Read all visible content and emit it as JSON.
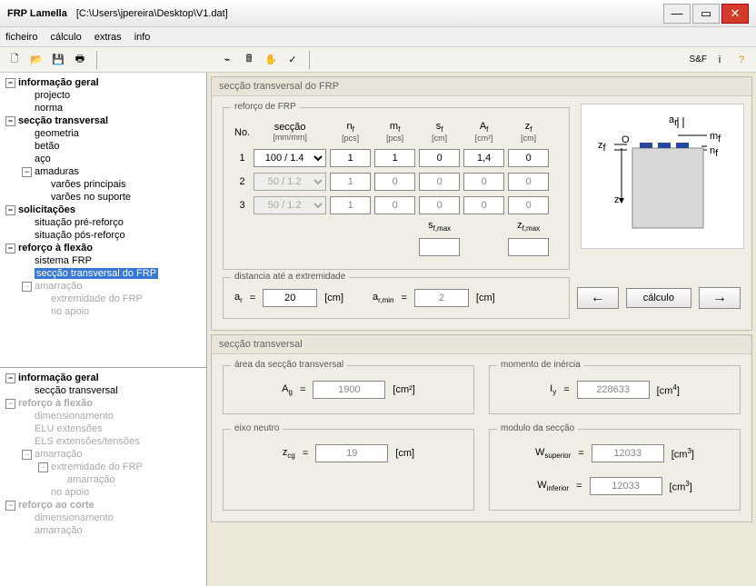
{
  "window": {
    "app": "FRP Lamella",
    "path": "[C:\\Users\\jpereira\\Desktop\\V1.dat]"
  },
  "menu": {
    "ficheiro": "ficheiro",
    "calculo": "cálculo",
    "extras": "extras",
    "info": "info"
  },
  "tree1": {
    "info_geral": "informação geral",
    "projecto": "projecto",
    "norma": "norma",
    "seccao_trans": "secção transversal",
    "geometria": "geometria",
    "betao": "betão",
    "aco": "aço",
    "amaduras": "amaduras",
    "varoes_principais": "varões principais",
    "varoes_suporte": "varões no suporte",
    "solicitacoes": "solicitações",
    "sit_pre": "situação pré-reforço",
    "sit_pos": "situação pós-reforço",
    "reforco_flexao": "reforço à flexão",
    "sistema_frp": "sistema FRP",
    "seccao_frp": "secção transversal do FRP",
    "amarracao": "amarração",
    "extremidade": "extremidade do FRP",
    "no_apoio": "no apoio"
  },
  "tree2": {
    "info_geral": "informação geral",
    "seccao_trans": "secção transversal",
    "reforco_flexao": "reforço à flexão",
    "dimensionamento": "dimensionamento",
    "elu": "ELU extensões",
    "els": "ELS extensões/tensões",
    "amarracao": "amarração",
    "extremidade": "extremidade do FRP",
    "amarracao2": "amarração",
    "no_apoio": "no apoio",
    "reforco_corte": "reforço ao corte",
    "dimensionamento2": "dimensionamento",
    "amarracao3": "amarração"
  },
  "panel1": {
    "title": "secção transversal do FRP",
    "reforco": "reforço de FRP",
    "no": "No.",
    "seccao": "secção",
    "seccao_u": "[mm/mm]",
    "nf": "n",
    "nf_sub": "f",
    "nf_u": "[pcs]",
    "mf": "m",
    "mf_sub": "f",
    "mf_u": "[pcs]",
    "sf": "s",
    "sf_sub": "f",
    "sf_u": "[cm]",
    "af": "A",
    "af_sub": "f",
    "af_u": "[cm²]",
    "zf": "z",
    "zf_sub": "f",
    "zf_u": "[cm]",
    "rows": [
      {
        "no": "1",
        "sec": "100 / 1.4",
        "nf": "1",
        "mf": "1",
        "sf": "0",
        "af": "1,4",
        "zf": "0",
        "active": true
      },
      {
        "no": "2",
        "sec": "50 / 1.2",
        "nf": "1",
        "mf": "0",
        "sf": "0",
        "af": "0",
        "zf": "0",
        "active": false
      },
      {
        "no": "3",
        "sec": "50 / 1.2",
        "nf": "1",
        "mf": "0",
        "sf": "0",
        "af": "0",
        "zf": "0",
        "active": false
      }
    ],
    "sfmax": "s",
    "sfmax_sub": "f,max",
    "zfmax": "z",
    "zfmax_sub": "f,max",
    "sfmax_val": "",
    "zfmax_val": "",
    "dist_label": "distancia até a extremidade",
    "ar": "a",
    "ar_sub": "r",
    "ar_val": "20",
    "armin": "a",
    "armin_sub": "r,min",
    "armin_val": "2",
    "cm": "[cm]",
    "calc": "cálculo",
    "diag": {
      "ar": "a",
      "ar_sub": "r",
      "zf": "z",
      "zf_sub": "f",
      "o": "O",
      "z": "z",
      "mf": "m",
      "mf_sub": "f",
      "nf": "n",
      "nf_sub": "f"
    }
  },
  "panel2": {
    "title": "secção transversal",
    "area": "área da secção transversal",
    "ag": "A",
    "ag_sub": "g",
    "ag_val": "1900",
    "ag_u": "[cm²]",
    "inercia": "momento de inércia",
    "iy": "I",
    "iy_sub": "y",
    "iy_val": "228633",
    "iy_u": "[cm",
    "iy_sup": "4",
    "iy_u2": "]",
    "eixo": "eixo neutro",
    "zcg": "z",
    "zcg_sub": "cg",
    "zcg_val": "19",
    "zcg_u": "[cm]",
    "modulo": "modulo da secção",
    "wsup": "W",
    "wsup_sub": "superior",
    "wsup_val": "12033",
    "winf": "W",
    "winf_sub": "inferior",
    "winf_val": "12033",
    "w_u": "[cm",
    "w_sup": "3",
    "w_u2": "]"
  }
}
